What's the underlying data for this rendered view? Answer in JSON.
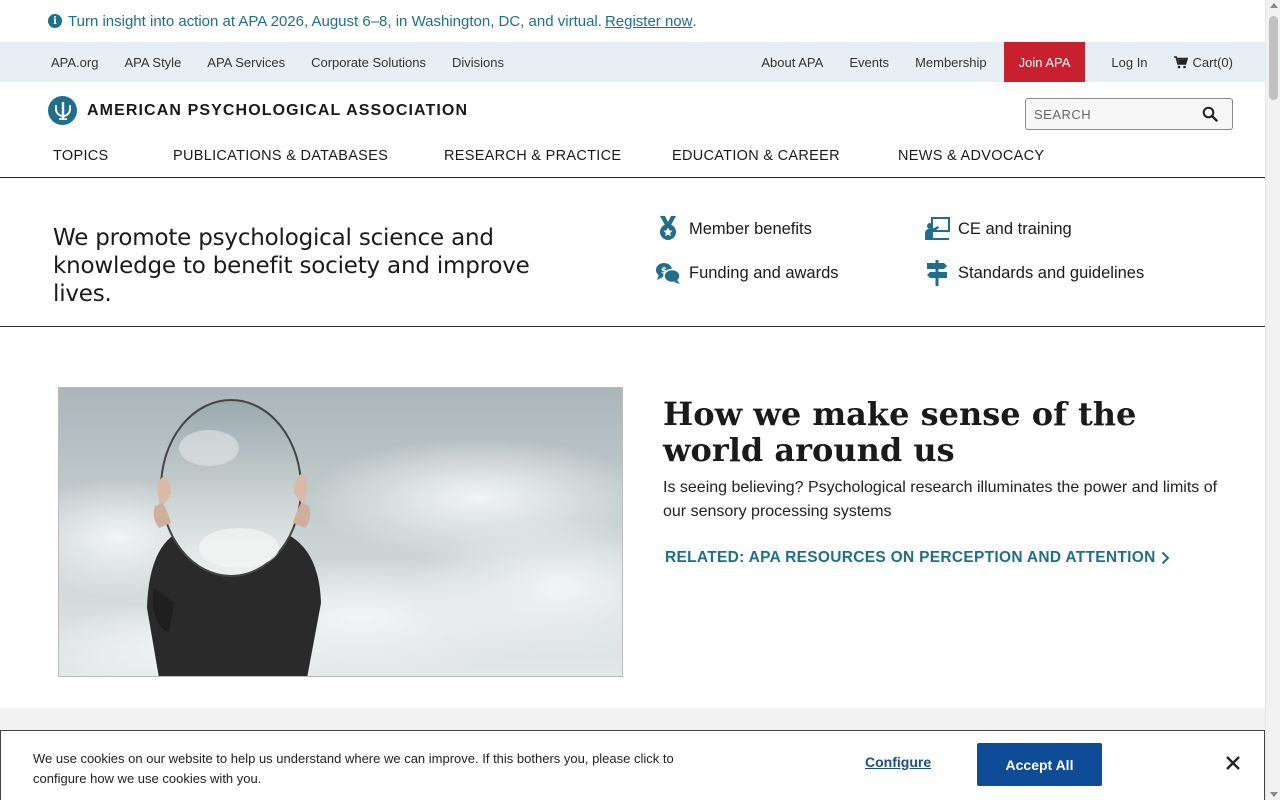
{
  "announcement": {
    "text": "Turn insight into action at APA 2026, August 6–8, in Washington, DC, and virtual.",
    "link": "Register now",
    "trailing": "."
  },
  "utility_nav": {
    "left": [
      "APA.org",
      "APA Style",
      "APA Services",
      "Corporate Solutions",
      "Divisions"
    ],
    "about": "About APA",
    "events": "Events",
    "membership": "Membership",
    "join": "Join APA",
    "login": "Log In",
    "cart": "Cart(0)"
  },
  "brand": {
    "name": "AMERICAN PSYCHOLOGICAL ASSOCIATION"
  },
  "search": {
    "placeholder": "SEARCH"
  },
  "main_nav": [
    "TOPICS",
    "PUBLICATIONS & DATABASES",
    "RESEARCH & PRACTICE",
    "EDUCATION & CAREER",
    "NEWS & ADVOCACY"
  ],
  "intro": {
    "tagline": "We promote psychological science and knowledge to benefit society and improve lives.",
    "links": {
      "member_benefits": "Member benefits",
      "ce_training": "CE and training",
      "funding_awards": "Funding and awards",
      "standards": "Standards and guidelines"
    }
  },
  "feature": {
    "title": "How we make sense of the world around us",
    "description": "Is seeing believing? Psychological research illuminates the power and limits of our sensory processing systems",
    "link": "RELATED: APA RESOURCES ON PERCEPTION AND ATTENTION"
  },
  "cookie": {
    "text": "We use cookies on our website to help us understand where we can improve. If this bothers you, please click to configure how we use cookies with you.",
    "configure": "Configure",
    "accept": "Accept All"
  },
  "colors": {
    "teal": "#1f6f8b",
    "join_red": "#c8202e",
    "accept_blue": "#0f4c97",
    "utility_bg": "#e8eff4"
  }
}
